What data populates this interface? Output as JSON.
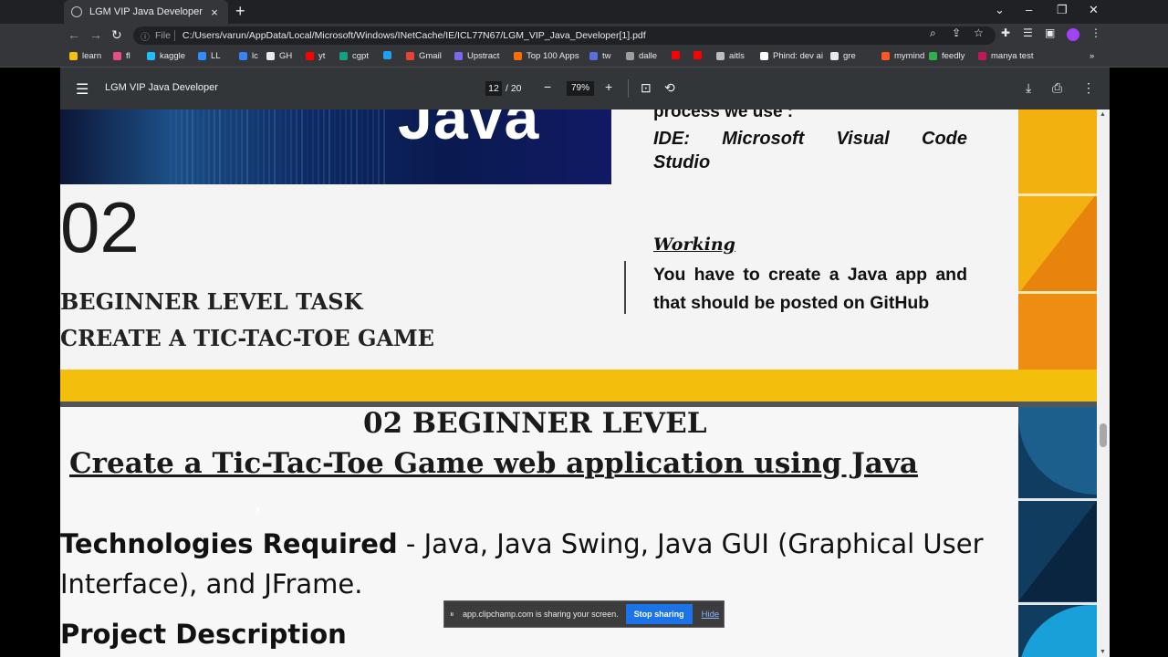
{
  "browser": {
    "tab_title": "LGM VIP Java Developer",
    "tab_close": "×",
    "new_tab": "+",
    "window_controls": {
      "dropdown": "⌄",
      "minimize": "–",
      "restore": "❐",
      "close": "✕"
    },
    "nav": {
      "back": "←",
      "forward": "→",
      "reload": "↻"
    },
    "address": {
      "scheme_label": "File",
      "url": "C:/Users/varun/AppData/Local/Microsoft/Windows/INetCache/IE/ICL77N67/LGM_VIP_Java_Developer[1].pdf"
    },
    "bookmarks": [
      {
        "label": "learn",
        "color": "#f4c20d"
      },
      {
        "label": "fl",
        "color": "#e84d8a"
      },
      {
        "label": "kaggle",
        "color": "#20beff"
      },
      {
        "label": "LL",
        "color": "#2d8cff"
      },
      {
        "label": "lc",
        "color": "#3b82f6"
      },
      {
        "label": "GH",
        "color": "#e8eaed"
      },
      {
        "label": "yt",
        "color": "#ff0000"
      },
      {
        "label": "cgpt",
        "color": "#10a37f"
      },
      {
        "label": "",
        "color": "#1da1f2"
      },
      {
        "label": "Gmail",
        "color": "#ea4335"
      },
      {
        "label": "Upstract",
        "color": "#7b68ee"
      },
      {
        "label": "Top 100 Apps",
        "color": "#ff6d00"
      },
      {
        "label": "tw",
        "color": "#5b6ee1"
      },
      {
        "label": "dalle",
        "color": "#9e9e9e"
      },
      {
        "label": "",
        "color": "#ff0000"
      },
      {
        "label": "",
        "color": "#ff0000"
      },
      {
        "label": "aitls",
        "color": "#bdbdbd"
      },
      {
        "label": "Phind: dev ai",
        "color": "#ffffff"
      },
      {
        "label": "gre",
        "color": "#e8eaed"
      },
      {
        "label": "mymind",
        "color": "#ff5722"
      },
      {
        "label": "feedly",
        "color": "#2bb24c"
      },
      {
        "label": "manya test",
        "color": "#c2185b"
      }
    ],
    "bookmarks_more": "»"
  },
  "pdf_toolbar": {
    "title": "LGM VIP Java Developer",
    "page_current": "12",
    "page_total": "/ 20",
    "zoom": "79%",
    "zoom_out": "−",
    "zoom_in": "+"
  },
  "slide1": {
    "image_word": "Java",
    "process_text": "process we use :",
    "ide_line1": "IDE: Microsoft Visual Code",
    "ide_line2": "Studio",
    "number": "02",
    "level_title": "BEGINNER LEVEL TASK",
    "task_title": "CREATE A TIC-TAC-TOE GAME",
    "working_heading": "Working",
    "working_text": "You have to create a  Java app and that should be posted on GitHub"
  },
  "slide2": {
    "heading": "02 BEGINNER LEVEL",
    "subheading": " Create a Tic-Tac-Toe Game  web application using Java",
    "tech_label": "Technologies Required",
    "tech_text": " - Java, Java Swing, Java GUI (Graphical User Interface), and JFrame.",
    "project_heading": "Project Description"
  },
  "share_bar": {
    "message": "app.clipchamp.com is sharing your screen.",
    "stop_label": "Stop sharing",
    "hide_label": "Hide"
  }
}
